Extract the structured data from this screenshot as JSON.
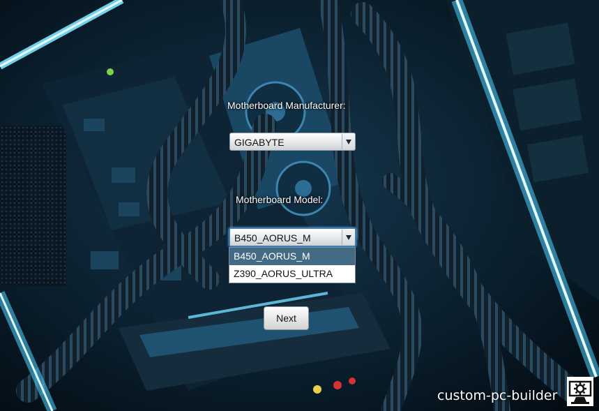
{
  "manufacturer": {
    "label": "Motherboard Manufacturer:",
    "selected": "GIGABYTE"
  },
  "model": {
    "label": "Motherboard Model:",
    "selected": "B450_AORUS_M",
    "options": [
      "B450_AORUS_M",
      "Z390_AORUS_ULTRA"
    ],
    "highlighted_index": 0
  },
  "next_button": {
    "label": "Next"
  },
  "branding": {
    "text": "custom-pc-builder",
    "icon": "monitor-gear-icon"
  },
  "colors": {
    "highlight": "#446b86",
    "focus_border": "#3d7fb6",
    "glow": "#2ec6ff"
  }
}
